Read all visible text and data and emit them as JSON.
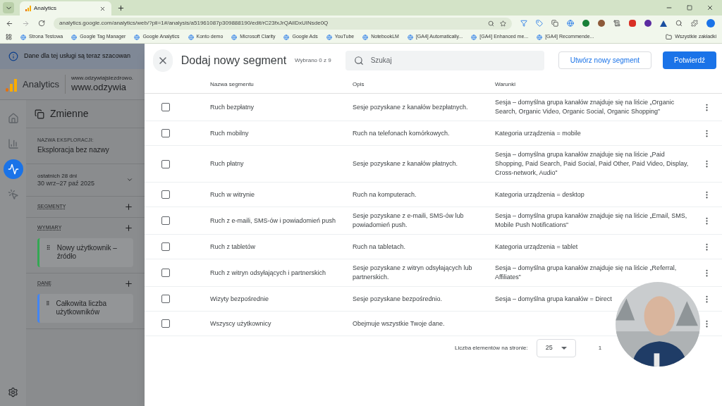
{
  "browser": {
    "tab_title": "Analytics",
    "url": "analytics.google.com/analytics/web/?pli=1#/analysis/a51961087p309888190/edit/rC23fxJrQAiIDxUINsde0Q",
    "bookmarks": [
      "Strona Testowa",
      "Google Tag Manager",
      "Google Analytics",
      "Konto demo",
      "Microsoft Clarity",
      "Google Ads",
      "YouTube",
      "NotebookLM",
      "[GA4] Automatically...",
      "[GA4] Enhanced me...",
      "[GA4] Recommende..."
    ],
    "all_bookmarks": "Wszystkie zakładki"
  },
  "banner": "Dane dla tej usługi są teraz szacowan",
  "header": {
    "product": "Analytics",
    "property_small": "www.odzywiajsiezdrowo.",
    "property": "www.odzywia"
  },
  "nav": [
    {
      "kind": "home",
      "selected": false
    },
    {
      "kind": "reports",
      "selected": false
    },
    {
      "kind": "explore",
      "selected": true
    },
    {
      "kind": "advertising",
      "selected": false
    }
  ],
  "variables": {
    "title": "Zmienne",
    "name_label": "NAZWA EKSPLORACJI:",
    "name": "Eksploracja bez nazwy",
    "range": "ostatnich 28 dni",
    "dates": "30 wrz–27 paź 2025",
    "sections": [
      {
        "title": "SEGMENTY"
      },
      {
        "title": "WYMIARY",
        "items": [
          {
            "label": "Nowy użytkownik – źródło",
            "color": "#34a853"
          }
        ]
      },
      {
        "title": "DANE",
        "items": [
          {
            "label": "Całkowita liczba użytkowników",
            "color": "#4285f4"
          }
        ]
      }
    ]
  },
  "dialog": {
    "title": "Dodaj nowy segment",
    "selected_count": "Wybrano 0 z 9",
    "search": {
      "placeholder": "Szukaj"
    },
    "create_button": "Utwórz nowy segment",
    "confirm_button": "Potwierdź",
    "table": {
      "columns": [
        "Nazwa segmentu",
        "Opis",
        "Warunki"
      ],
      "rows": [
        {
          "name": "Ruch bezpłatny",
          "description": "Sesje pozyskane z kanałów bezpłatnych.",
          "conditions": "Sesja – domyślna grupa kanałów znajduje się na liście „Organic Search, Organic Video, Organic Social, Organic Shopping”",
          "checked": false
        },
        {
          "name": "Ruch mobilny",
          "description": "Ruch na telefonach komórkowych.",
          "conditions": "Kategoria urządzenia = mobile",
          "checked": false
        },
        {
          "name": "Ruch płatny",
          "description": "Sesje pozyskane z kanałów płatnych.",
          "conditions": "Sesja – domyślna grupa kanałów znajduje się na liście „Paid Shopping, Paid Search, Paid Social, Paid Other, Paid Video, Display, Cross-network, Audio”",
          "checked": false
        },
        {
          "name": "Ruch w witrynie",
          "description": "Ruch na komputerach.",
          "conditions": "Kategoria urządzenia = desktop",
          "checked": false
        },
        {
          "name": "Ruch z e-maili, SMS-ów i powiadomień push",
          "description": "Sesje pozyskane z e-maili, SMS-ów lub powiadomień push.",
          "conditions": "Sesja – domyślna grupa kanałów znajduje się na liście „Email, SMS, Mobile Push Notifications”",
          "checked": false
        },
        {
          "name": "Ruch z tabletów",
          "description": "Ruch na tabletach.",
          "conditions": "Kategoria urządzenia = tablet",
          "checked": false
        },
        {
          "name": "Ruch z witryn odsyłających i partnerskich",
          "description": "Sesje pozyskane z witryn odsyłających lub partnerskich.",
          "conditions": "Sesja – domyślna grupa kanałów znajduje się na liście „Referral, Affiliates”",
          "checked": false
        },
        {
          "name": "Wizyty bezpośrednie",
          "description": "Sesje pozyskane bezpośrednio.",
          "conditions": "Sesja – domyślna grupa kanałów = Direct",
          "checked": false
        },
        {
          "name": "Wszyscy użytkownicy",
          "description": "Obejmuje wszystkie Twoje dane.",
          "checked": false
        }
      ]
    },
    "pagination": {
      "label": "Liczba elementów na stronie:",
      "page_size": "25",
      "range": "1"
    }
  }
}
